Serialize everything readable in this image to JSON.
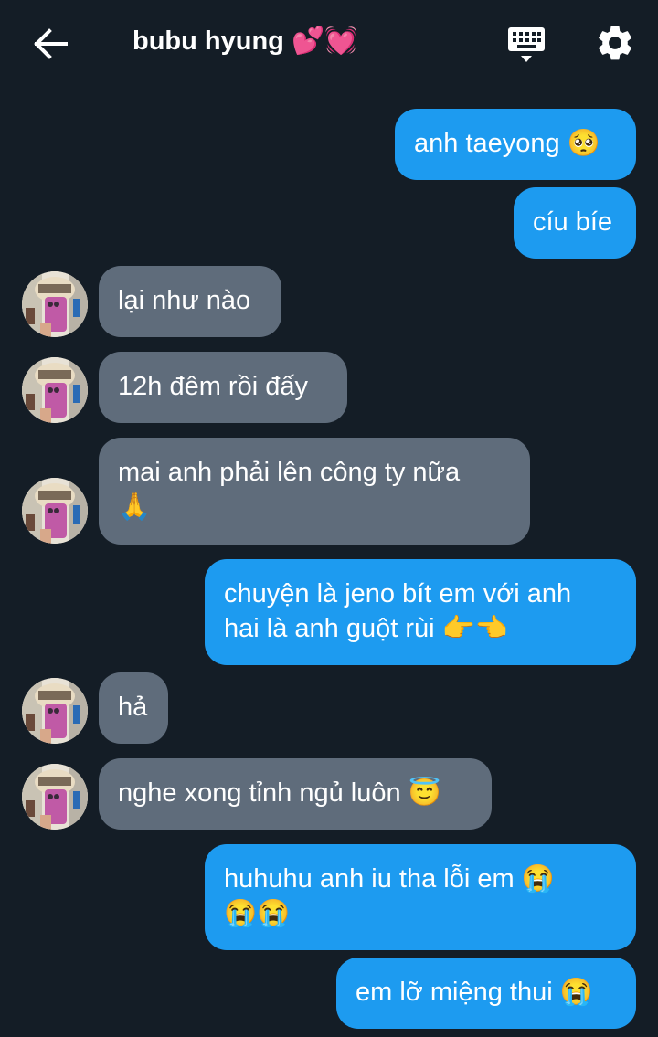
{
  "header": {
    "title": "bubu hyung 💕💓",
    "back_icon": "arrow-left-icon",
    "keyboard_icon": "keyboard-icon",
    "settings_icon": "gear-icon"
  },
  "colors": {
    "background": "#141d26",
    "outgoing_bubble": "#1d9bf0",
    "incoming_bubble": "#5f6c7b"
  },
  "messages": [
    {
      "sender": "me",
      "text": "anh taeyong 🥺"
    },
    {
      "sender": "me",
      "text": "cíu bíe"
    },
    {
      "sender": "them",
      "text": "lại như nào"
    },
    {
      "sender": "them",
      "text": "12h đêm rồi đấy"
    },
    {
      "sender": "them",
      "text": "mai anh phải lên công ty nữa\n🙏"
    },
    {
      "sender": "me",
      "text": "chuyện là jeno bít em với anh\nhai là anh guột rùi 👉👈"
    },
    {
      "sender": "them",
      "text": "hả"
    },
    {
      "sender": "them",
      "text": "nghe xong tỉnh ngủ luôn 😇"
    },
    {
      "sender": "me",
      "text": "huhuhu anh iu tha lỗi em 😭\n😭😭"
    },
    {
      "sender": "me",
      "text": "em lỡ miệng thui 😭"
    }
  ]
}
